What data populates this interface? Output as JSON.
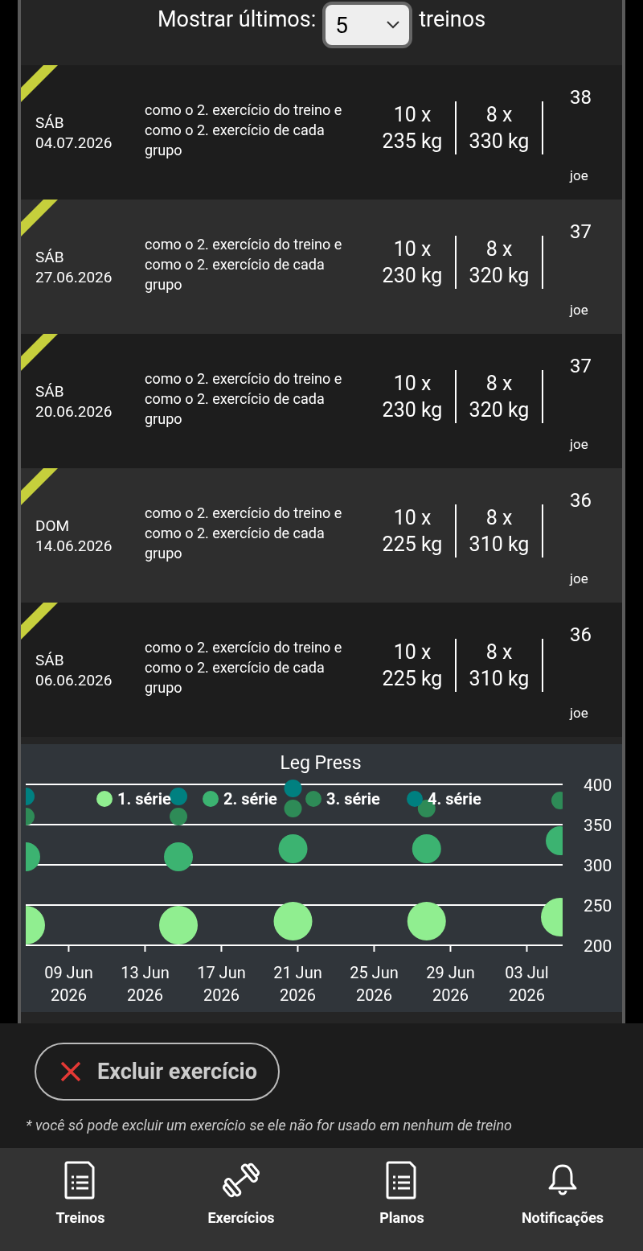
{
  "filter": {
    "label": "Mostrar últimos:",
    "value": "5",
    "suffix": "treinos"
  },
  "workouts": [
    {
      "day": "SÁB",
      "date": "04.07.2026",
      "note": "como o 2. exercício do treino e como o 2. exercício de cada grupo",
      "sets": [
        {
          "reps": "10 x",
          "weight": "235 kg"
        },
        {
          "reps": "8 x",
          "weight": "330 kg"
        }
      ],
      "cut_set": "38",
      "user": "joe"
    },
    {
      "day": "SÁB",
      "date": "27.06.2026",
      "note": "como o 2. exercício do treino e como o 2. exercício de cada grupo",
      "sets": [
        {
          "reps": "10 x",
          "weight": "230 kg"
        },
        {
          "reps": "8 x",
          "weight": "320 kg"
        }
      ],
      "cut_set": "37",
      "user": "joe"
    },
    {
      "day": "SÁB",
      "date": "20.06.2026",
      "note": "como o 2. exercício do treino e como o 2. exercício de cada grupo",
      "sets": [
        {
          "reps": "10 x",
          "weight": "230 kg"
        },
        {
          "reps": "8 x",
          "weight": "320 kg"
        }
      ],
      "cut_set": "37",
      "user": "joe"
    },
    {
      "day": "DOM",
      "date": "14.06.2026",
      "note": "como o 2. exercício do treino e como o 2. exercício de cada grupo",
      "sets": [
        {
          "reps": "10 x",
          "weight": "225 kg"
        },
        {
          "reps": "8 x",
          "weight": "310 kg"
        }
      ],
      "cut_set": "36",
      "user": "joe"
    },
    {
      "day": "SÁB",
      "date": "06.06.2026",
      "note": "como o 2. exercício do treino e como o 2. exercício de cada grupo",
      "sets": [
        {
          "reps": "10 x",
          "weight": "225 kg"
        },
        {
          "reps": "8 x",
          "weight": "310 kg"
        }
      ],
      "cut_set": "36",
      "user": "joe"
    }
  ],
  "chart": {
    "chart_data": {
      "type": "scatter",
      "grid": true,
      "legend": "top",
      "title": "Leg Press",
      "x": [
        "2026-06-06T18:00",
        "2026-06-14T18:00",
        "2026-06-20T18:00",
        "2026-06-27T18:00",
        "2026-07-04T18:00"
      ],
      "xlim": [
        "2026-06-06T18:00",
        "2026-07-04T21:00"
      ],
      "ylim": [
        200,
        400
      ],
      "xticks": [
        {
          "value": "2026-06-09",
          "label": "09 Jun 2026"
        },
        {
          "value": "2026-06-13",
          "label": "13 Jun 2026"
        },
        {
          "value": "2026-06-17",
          "label": "17 Jun 2026"
        },
        {
          "value": "2026-06-21",
          "label": "21 Jun 2026"
        },
        {
          "value": "2026-06-25",
          "label": "25 Jun 2026"
        },
        {
          "value": "2026-06-29",
          "label": "29 Jun 2026"
        },
        {
          "value": "2026-07-03",
          "label": "03 Jul 2026"
        }
      ],
      "yticks": [
        200,
        250,
        300,
        350,
        400
      ],
      "series": [
        {
          "name": "1. série",
          "color": "#90ee90",
          "values": [
            225,
            225,
            230,
            230,
            235
          ]
        },
        {
          "name": "2. série",
          "color": "#3cb371",
          "values": [
            310,
            310,
            320,
            320,
            330
          ]
        },
        {
          "name": "3. série",
          "color": "#2e8b57",
          "values": [
            360,
            360,
            370,
            370,
            380
          ]
        },
        {
          "name": "4. série",
          "color": "#008080",
          "values": [
            385,
            385,
            395,
            null,
            null
          ]
        }
      ]
    }
  },
  "delete_button": {
    "label": "Excluir exercício"
  },
  "footnote": "* você só pode excluir um exercício se ele não for usado em nenhum de treino",
  "nav": [
    {
      "label": "Treinos",
      "kind": "document"
    },
    {
      "label": "Exercícios",
      "kind": "dumbbell"
    },
    {
      "label": "Planos",
      "kind": "document"
    },
    {
      "label": "Notificações",
      "kind": "bell"
    }
  ]
}
